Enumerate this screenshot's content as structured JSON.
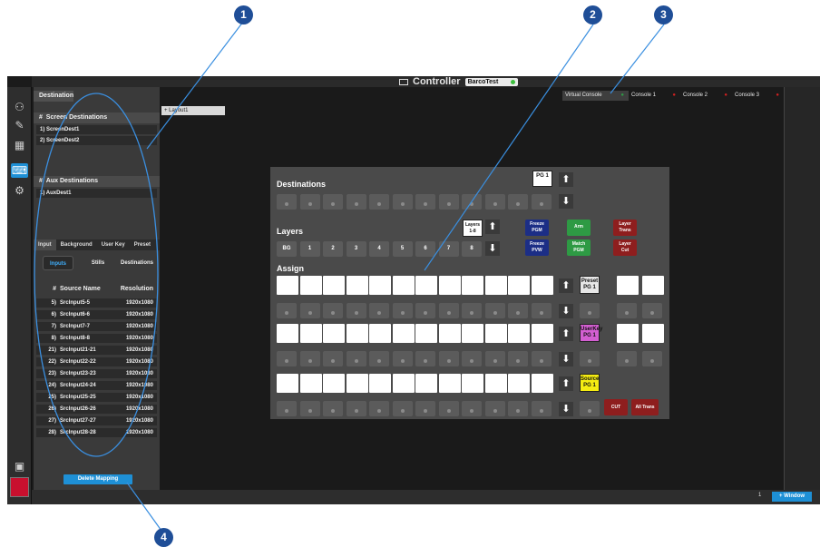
{
  "window": {
    "title": "Controller",
    "tag": "BarcoTest"
  },
  "destination_tab": "Destination",
  "screen_destinations": {
    "header_hash": "#",
    "header": "Screen Destinations",
    "items": [
      "1) ScreenDest1",
      "2) ScreenDest2"
    ]
  },
  "aux_destinations": {
    "header_hash": "#",
    "header": "Aux Destinations",
    "items": [
      "1) AuxDest1"
    ]
  },
  "input_tabs": [
    "Input",
    "Background",
    "User Key",
    "Preset"
  ],
  "sub_buttons": [
    "Inputs",
    "Stills",
    "Destinations"
  ],
  "source_table": {
    "headers": [
      "#",
      "Source Name",
      "Resolution"
    ],
    "rows": [
      [
        "5)",
        "SrcInput5-5",
        "1920x1080"
      ],
      [
        "6)",
        "SrcInput6-6",
        "1920x1080"
      ],
      [
        "7)",
        "SrcInput7-7",
        "1920x1080"
      ],
      [
        "8)",
        "SrcInput8-8",
        "1920x1080"
      ],
      [
        "21)",
        "SrcInput21-21",
        "1920x1080"
      ],
      [
        "22)",
        "SrcInput22-22",
        "1920x1080"
      ],
      [
        "23)",
        "SrcInput23-23",
        "1920x1080"
      ],
      [
        "24)",
        "SrcInput24-24",
        "1920x1080"
      ],
      [
        "25)",
        "SrcInput25-25",
        "1920x1080"
      ],
      [
        "26)",
        "SrcInput26-26",
        "1920x1080"
      ],
      [
        "27)",
        "SrcInput27-27",
        "1920x1080"
      ],
      [
        "28)",
        "SrcInput28-28",
        "1920x1080"
      ]
    ]
  },
  "delete_mapping": "Delete Mapping",
  "layout_chip": "+ Layout1",
  "console_tabs": [
    "Virtual Console",
    "Console 1",
    "Console 2",
    "Console 3"
  ],
  "console": {
    "destinations_label": "Destinations",
    "layers_label": "Layers",
    "assign_label": "Assign",
    "pg1": "PG 1",
    "layers_range": "Layers\n1-8",
    "layer_buttons": [
      "BG",
      "1",
      "2",
      "3",
      "4",
      "5",
      "6",
      "7",
      "8"
    ],
    "freeze_pgm": "Freeze\nPGM",
    "freeze_pvw": "Freeze\nPVW",
    "arm": "Arm",
    "match_pgm": "Match\nPGM",
    "layer_trans": "Layer\nTrans",
    "layer_cut": "Layer\nCut",
    "preset_pg": "Preset\nPG 1",
    "userkey_pg": "UserKey\nPG 1",
    "source_pg": "Source\nPG 1",
    "cut": "CUT",
    "all_trans": "All Trans"
  },
  "bottom": {
    "page": "1",
    "window_btn": "+ Window"
  },
  "callouts": [
    "1",
    "2",
    "3",
    "4"
  ],
  "colors": {
    "accent": "#1e90d6",
    "callout": "#1f4e97",
    "freeze": "#1c2e86",
    "green": "#2e9a44",
    "red": "#8e1e1e",
    "userkey": "#d35fd1",
    "source": "#f5ec12"
  }
}
